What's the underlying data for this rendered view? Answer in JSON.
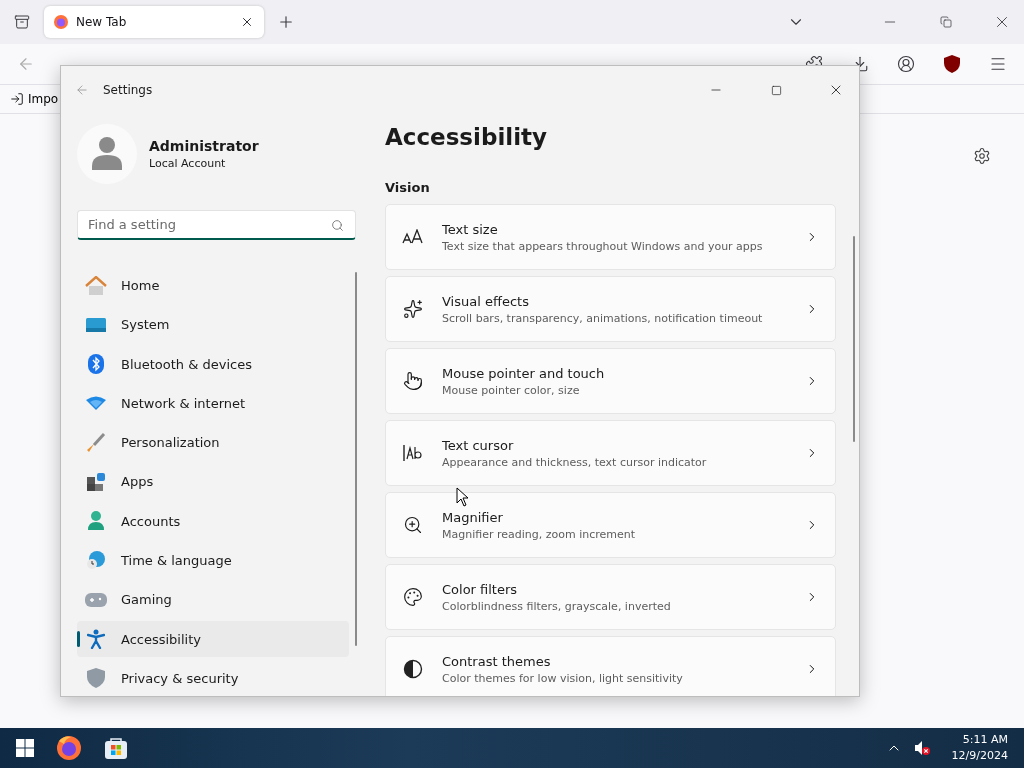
{
  "browser": {
    "tabs": [
      {
        "label": "New Tab",
        "selected": true
      }
    ],
    "bookmarks": [
      {
        "label": "Impo"
      }
    ]
  },
  "settings": {
    "title": "Settings",
    "profile": {
      "name": "Administrator",
      "account": "Local Account"
    },
    "search": {
      "placeholder": "Find a setting"
    },
    "nav": [
      {
        "label": "Home",
        "selected": false
      },
      {
        "label": "System",
        "selected": false
      },
      {
        "label": "Bluetooth & devices",
        "selected": false
      },
      {
        "label": "Network & internet",
        "selected": false
      },
      {
        "label": "Personalization",
        "selected": false
      },
      {
        "label": "Apps",
        "selected": false
      },
      {
        "label": "Accounts",
        "selected": false
      },
      {
        "label": "Time & language",
        "selected": false
      },
      {
        "label": "Gaming",
        "selected": false
      },
      {
        "label": "Accessibility",
        "selected": true
      },
      {
        "label": "Privacy & security",
        "selected": false
      }
    ],
    "heading": "Accessibility",
    "section": "Vision",
    "cards": [
      {
        "title": "Text size",
        "description": "Text size that appears throughout Windows and your apps"
      },
      {
        "title": "Visual effects",
        "description": "Scroll bars, transparency, animations, notification timeout"
      },
      {
        "title": "Mouse pointer and touch",
        "description": "Mouse pointer color, size"
      },
      {
        "title": "Text cursor",
        "description": "Appearance and thickness, text cursor indicator"
      },
      {
        "title": "Magnifier",
        "description": "Magnifier reading, zoom increment"
      },
      {
        "title": "Color filters",
        "description": "Colorblindness filters, grayscale, inverted"
      },
      {
        "title": "Contrast themes",
        "description": "Color themes for low vision, light sensitivity"
      }
    ]
  },
  "taskbar": {
    "time": "5:11 AM",
    "date": "12/9/2024"
  }
}
